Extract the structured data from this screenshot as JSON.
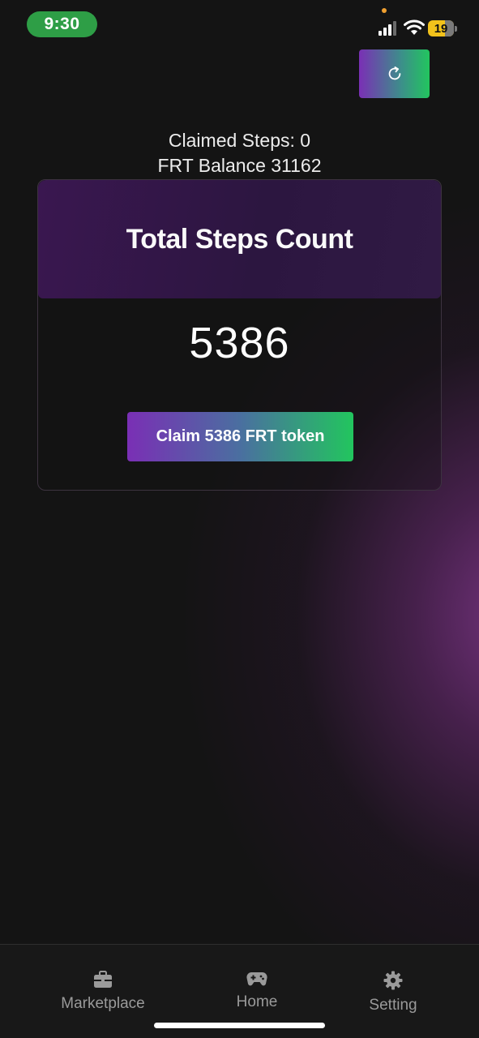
{
  "status_bar": {
    "time": "9:30",
    "battery": "19",
    "icons": [
      "signal-icon",
      "wifi-icon",
      "battery-icon"
    ]
  },
  "toolbar": {
    "refresh_icon": "refresh-icon"
  },
  "summary": {
    "claimed_steps": "Claimed Steps: 0",
    "frt_balance": "FRT Balance 31162"
  },
  "card": {
    "title": "Total Steps Count",
    "steps": "5386",
    "claim_button": "Claim 5386 FRT token"
  },
  "nav": {
    "items": [
      {
        "label": "Marketplace",
        "icon": "briefcase-icon"
      },
      {
        "label": "Home",
        "icon": "gamepad-icon"
      },
      {
        "label": "Setting",
        "icon": "gear-icon"
      }
    ]
  },
  "colors": {
    "accent_purple": "#7a2fb5",
    "accent_green": "#22c55e",
    "time_pill": "#2e9e46",
    "battery": "#f2c21b"
  }
}
